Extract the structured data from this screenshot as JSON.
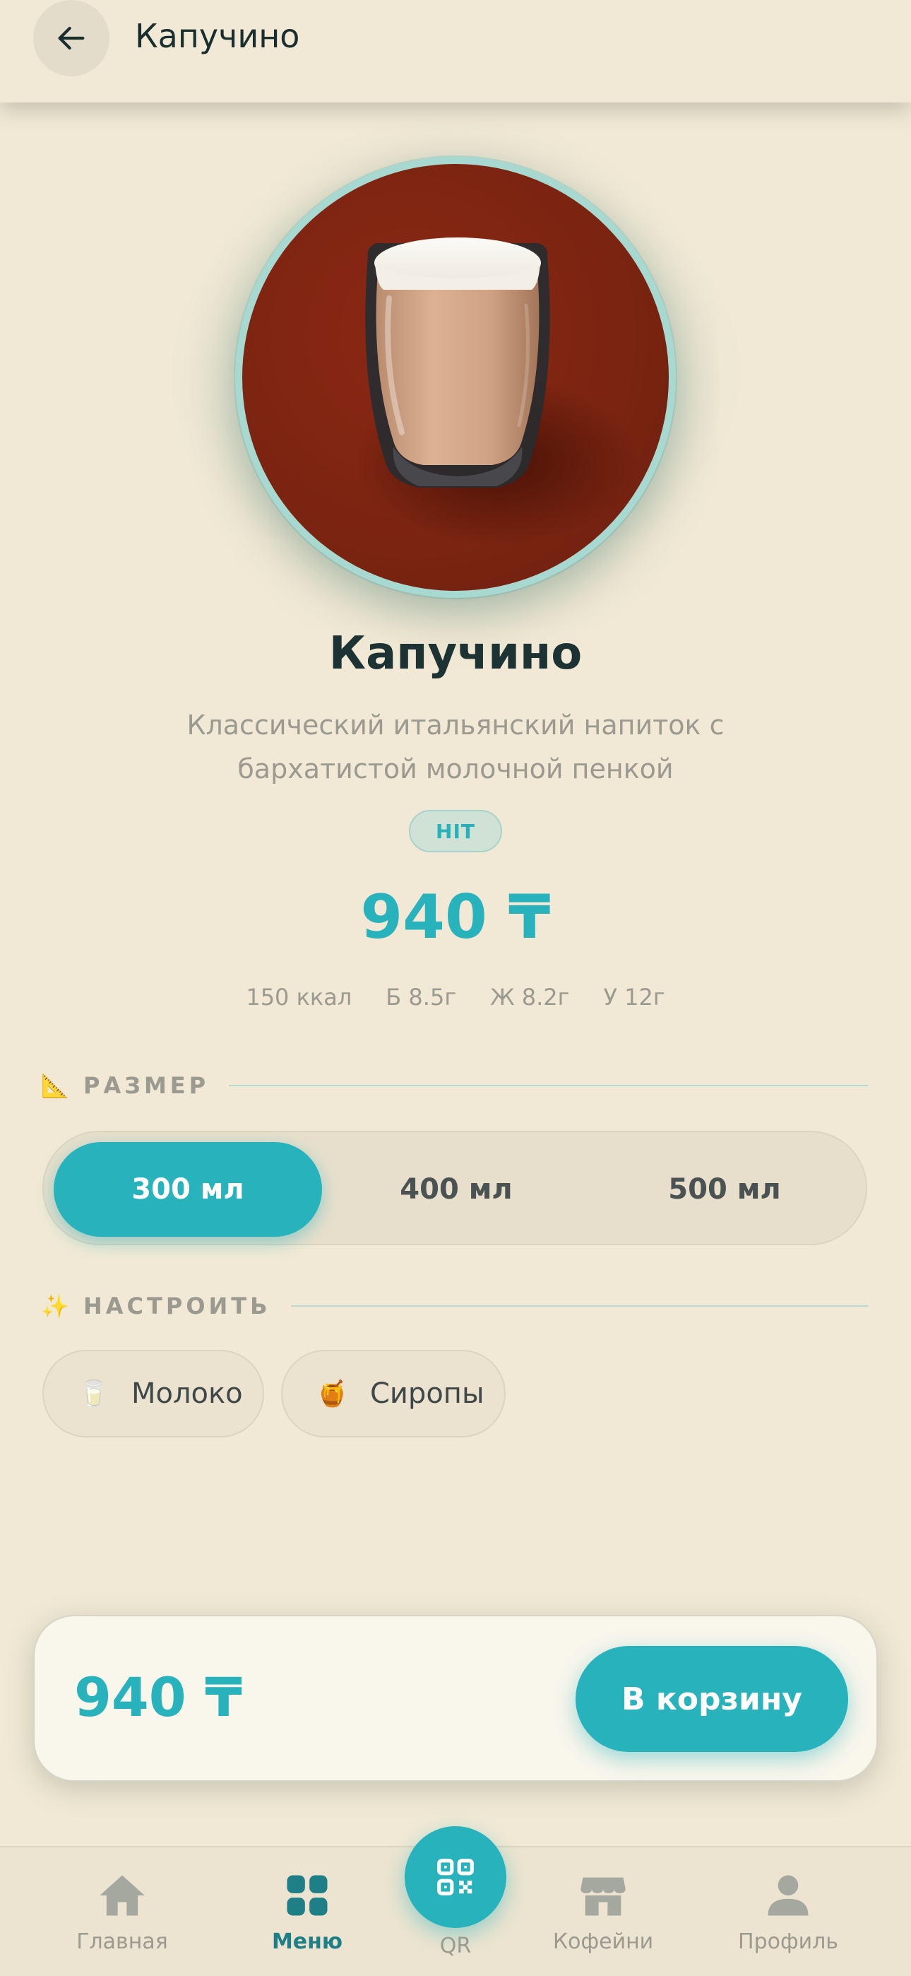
{
  "header": {
    "title": "Капучино",
    "back_icon": "arrow-left-icon"
  },
  "product": {
    "name": "Капучино",
    "description": "Классический итальянский напиток с бархатистой молочной пенкой",
    "badge": "HIT",
    "price": "940 ₸",
    "nutrition": [
      "150 ккал",
      "Б 8.5г",
      "Ж 8.2г",
      "У 12г"
    ]
  },
  "size_section": {
    "icon": "📐",
    "label": "РАЗМЕР",
    "options": [
      "300 мл",
      "400 мл",
      "500 мл"
    ],
    "selected": "300 мл"
  },
  "customize_section": {
    "icon": "✨",
    "label": "НАСТРОИТЬ",
    "chips": [
      {
        "icon": "🥛",
        "label": "Молоко"
      },
      {
        "icon": "🍯",
        "label": "Сиропы"
      }
    ]
  },
  "cart": {
    "price": "940 ₸",
    "button_label": "В корзину"
  },
  "nav": {
    "items": [
      {
        "label": "Главная",
        "icon": "home-icon"
      },
      {
        "label": "Меню",
        "icon": "grid-icon"
      },
      {
        "label": "QR",
        "icon": "qr-code-icon"
      },
      {
        "label": "Кофейни",
        "icon": "store-icon"
      },
      {
        "label": "Профиль",
        "icon": "person-icon"
      }
    ],
    "active": "Меню"
  },
  "colors": {
    "background": "#f1e9d5",
    "accent": "#27b2bc",
    "accent_dark": "#1e7f86",
    "text_dark": "#1b2e2e",
    "text_muted": "#9a9a90"
  }
}
